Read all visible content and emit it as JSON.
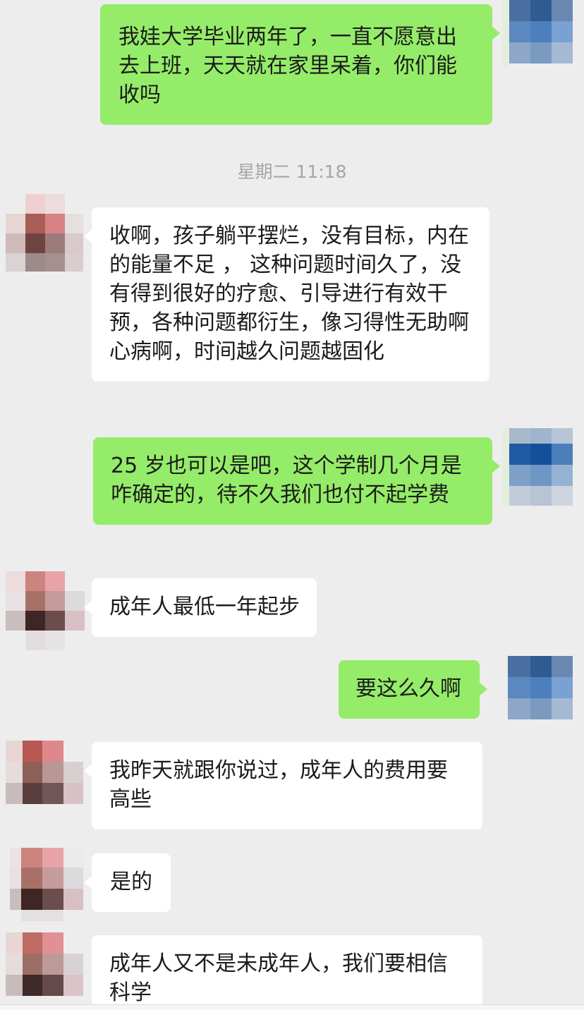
{
  "timestamp": "星期二 11:18",
  "messages": [
    {
      "side": "right",
      "text": "我娃大学毕业两年了，一直不愿意出去上班，天天就在家里呆着，你们能收吗"
    },
    {
      "side": "left",
      "text": "收啊，孩子躺平摆烂，没有目标，内在的能量不足 ， 这种问题时间久了，没有得到很好的疗愈、引导进行有效干预，各种问题都衍生，像习得性无助啊 心病啊，时间越久问题越固化"
    },
    {
      "side": "right",
      "text": "25 岁也可以是吧，这个学制几个月是咋确定的，待不久我们也付不起学费"
    },
    {
      "side": "left",
      "text": "成年人最低一年起步"
    },
    {
      "side": "right",
      "text": "要这么久啊"
    },
    {
      "side": "left",
      "text": "我昨天就跟你说过，成年人的费用要高些"
    },
    {
      "side": "left",
      "text": "是的"
    },
    {
      "side": "left",
      "text": "成年人又不是未成年人，我们要相信科学"
    }
  ],
  "avatars": {
    "self": {
      "label": "self-avatar",
      "colors": [
        "#4a6fa0",
        "#3d6494",
        "#6a87b2",
        "#5a88bf",
        "#4c7fbd",
        "#7aa1d3",
        "#8ea7c8",
        "#7b9ac0",
        "#a4b9d3"
      ]
    },
    "other": {
      "label": "other-avatar",
      "colors": [
        "#ecd6d6",
        "#e9c2c5",
        "#ecdfe0",
        "#c98a86",
        "#b8606a",
        "#e5b7bb",
        "#7e5452",
        "#8d6765",
        "#d8c3c6"
      ]
    }
  }
}
